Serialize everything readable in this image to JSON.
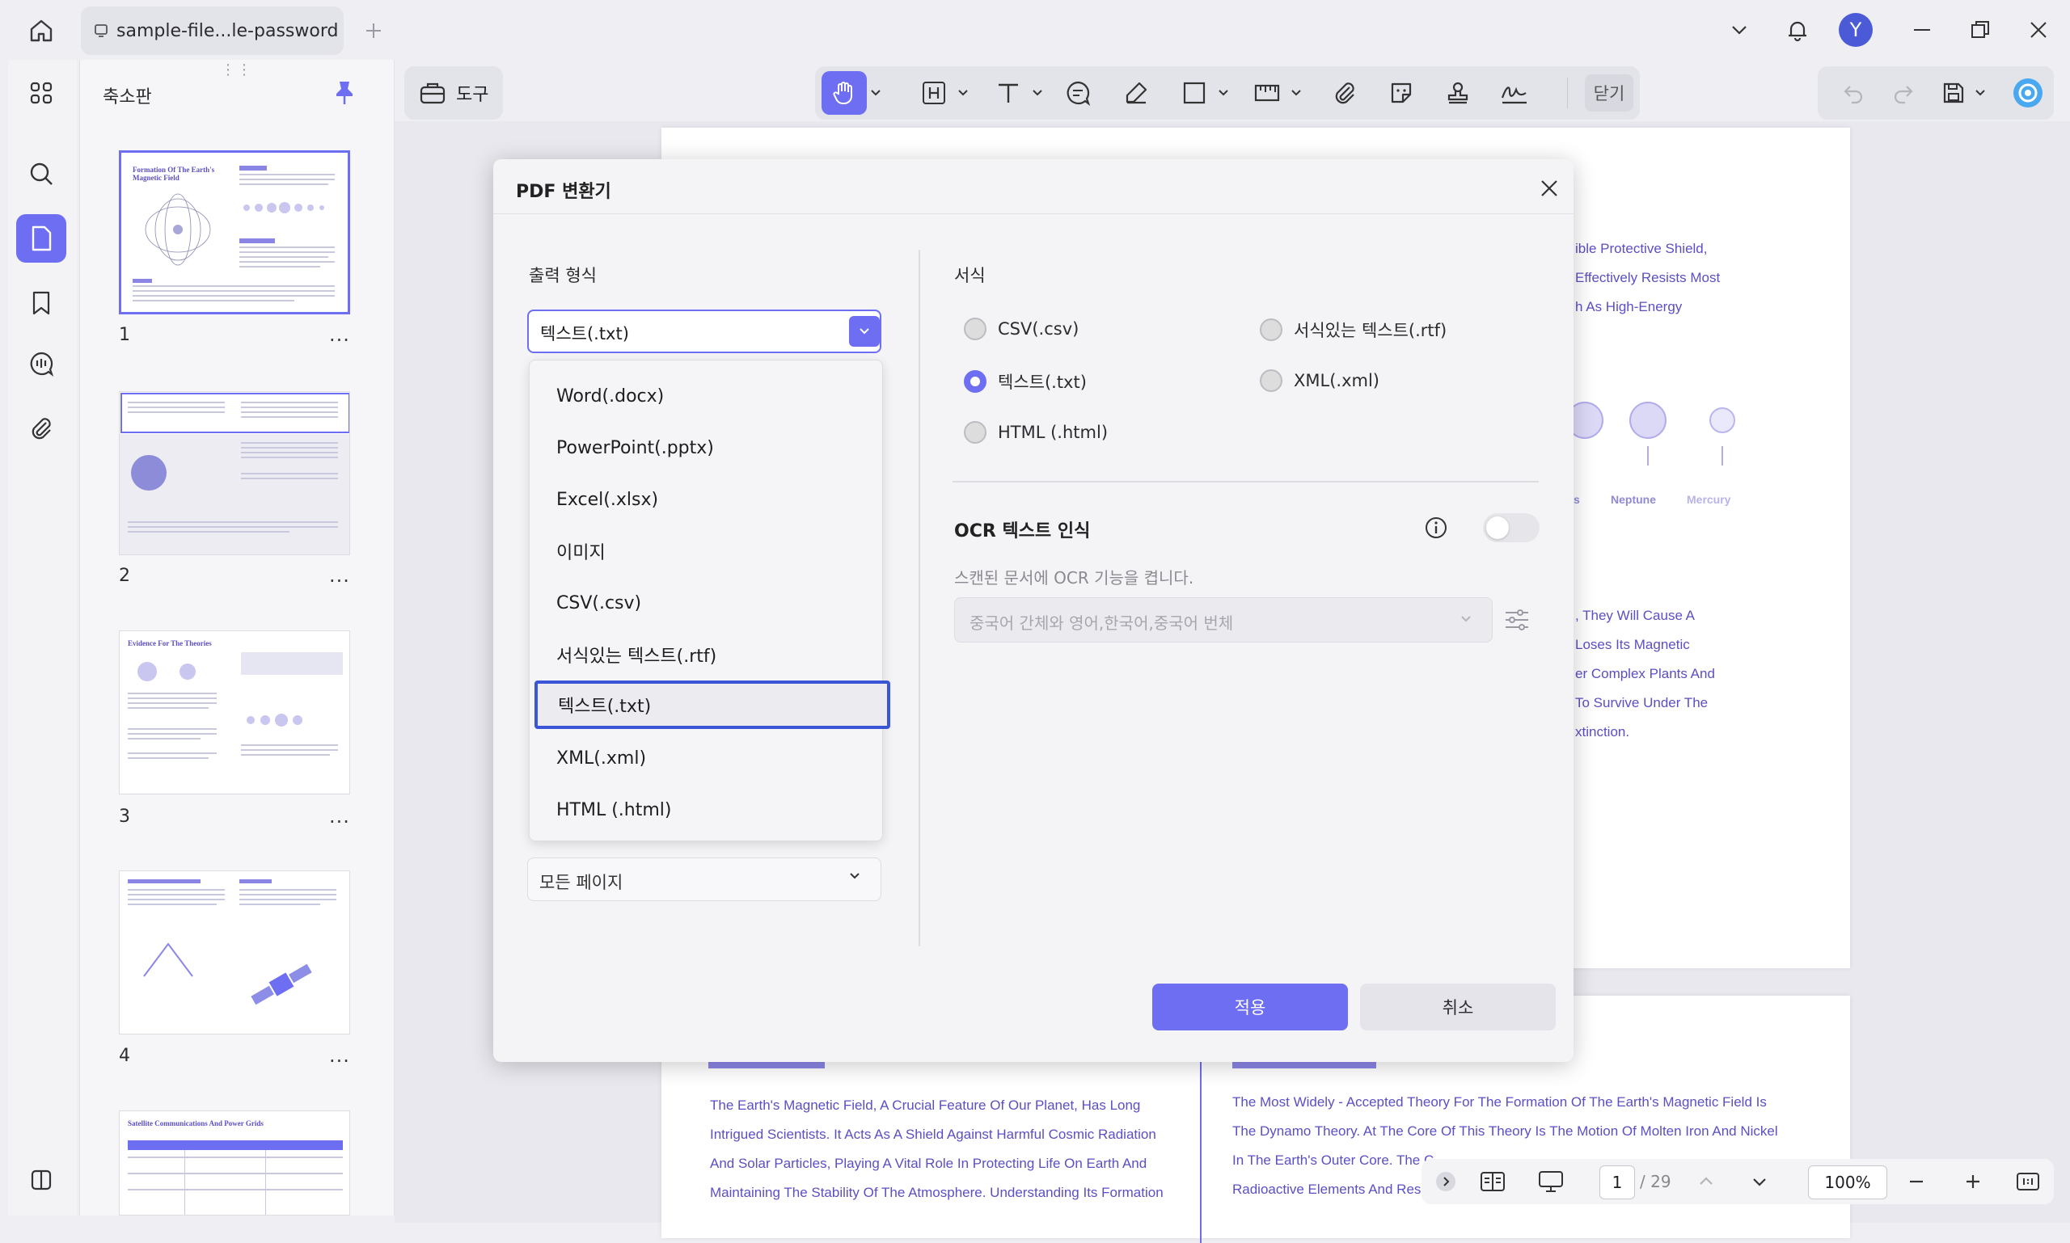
{
  "tab": {
    "title": "sample-file...le-password"
  },
  "user": {
    "initial": "Y"
  },
  "sidebar": {
    "panel_title": "축소판"
  },
  "thumbnails": [
    {
      "number": "1",
      "heading": "Formation Of The Earth's Magnetic Field",
      "more": "..."
    },
    {
      "number": "2",
      "heading": "",
      "more": "..."
    },
    {
      "number": "3",
      "heading": "Evidence For The Theories",
      "more": "..."
    },
    {
      "number": "4",
      "heading": "",
      "more": "..."
    },
    {
      "number": "",
      "heading": "Satellite Communications And Power Grids",
      "more": ""
    }
  ],
  "toolbar": {
    "tools_label": "도구",
    "close_label": "닫기"
  },
  "dialog": {
    "title": "PDF 변환기",
    "output_format_label": "출력 형식",
    "selected_format": "텍스트(.txt)",
    "format_options": [
      "Word(.docx)",
      "PowerPoint(.pptx)",
      "Excel(.xlsx)",
      "이미지",
      "CSV(.csv)",
      "서식있는 텍스트(.rtf)",
      "텍스트(.txt)",
      "XML(.xml)",
      "HTML (.html)"
    ],
    "page_range_value": "모든 페이지",
    "format_section_label": "서식",
    "radio_options": [
      {
        "label": "CSV(.csv)",
        "checked": false
      },
      {
        "label": "서식있는 텍스트(.rtf)",
        "checked": false
      },
      {
        "label": "텍스트(.txt)",
        "checked": true
      },
      {
        "label": "XML(.xml)",
        "checked": false
      },
      {
        "label": "HTML (.html)",
        "checked": false
      }
    ],
    "ocr_title": "OCR 텍스트 인식",
    "ocr_enabled": false,
    "ocr_description": "스캔된 문서에 OCR 기능을 켭니다.",
    "ocr_language": "중국어 간체와 영어,한국어,중국어 번체",
    "apply_label": "적용",
    "cancel_label": "취소"
  },
  "document": {
    "page1_right_lines": [
      "ible Protective Shield,",
      "Effectively Resists Most",
      "h As High-Energy"
    ],
    "planet_labels": [
      "s",
      "Neptune",
      "Mercury"
    ],
    "page1_right_lines2": [
      ", They Will Cause A",
      "Loses Its Magnetic",
      "er Complex Plants And",
      "To Survive Under The",
      "xtinction."
    ],
    "page2_left_lines": [
      "The Earth's Magnetic Field, A Crucial Feature Of Our Planet, Has Long",
      "Intrigued Scientists. It Acts As A Shield Against Harmful Cosmic Radiation",
      "And Solar Particles, Playing A Vital Role In Protecting Life On Earth And",
      "Maintaining The Stability Of The Atmosphere. Understanding Its Formation"
    ],
    "page2_right_lines": [
      "The Most Widely - Accepted Theory For The Formation Of The Earth's Magnetic Field Is",
      "The Dynamo Theory. At The Core Of This Theory Is The Motion Of Molten Iron And Nickel",
      "In The Earth's Outer Core. The C",
      "Radioactive Elements And Resi"
    ]
  },
  "bottombar": {
    "current_page": "1",
    "total_pages": "/ 29",
    "zoom": "100%"
  },
  "colors": {
    "accent": "#6d6ef2",
    "doc_text": "#5b4fc4"
  }
}
